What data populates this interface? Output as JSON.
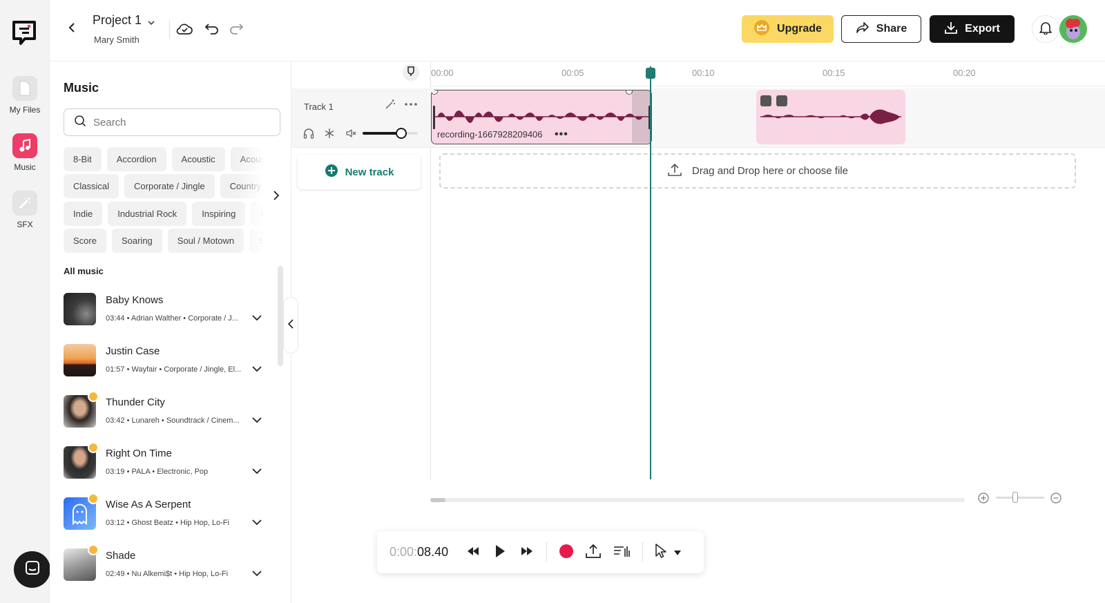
{
  "rail": {
    "items": [
      {
        "label": "My Files",
        "icon": "file-icon"
      },
      {
        "label": "Music",
        "icon": "music-note-icon"
      },
      {
        "label": "SFX",
        "icon": "magic-wand-icon"
      }
    ]
  },
  "header": {
    "project_title": "Project 1",
    "user_name": "Mary Smith",
    "upgrade_label": "Upgrade",
    "share_label": "Share",
    "export_label": "Export"
  },
  "panel": {
    "title": "Music",
    "search_placeholder": "Search",
    "chip_rows": [
      [
        "8-Bit",
        "Accordion",
        "Acoustic",
        "Acoustic"
      ],
      [
        "Classical",
        "Corporate / Jingle",
        "Country"
      ],
      [
        "Indie",
        "Industrial Rock",
        "Inspiring",
        "Inte"
      ],
      [
        "Score",
        "Soaring",
        "Soul / Motown",
        "Sou"
      ]
    ],
    "section_label": "All music",
    "songs": [
      {
        "title": "Baby Knows",
        "duration": "03:44",
        "artist": "Adrian Walther",
        "genre": "Corporate / J...",
        "premium": false
      },
      {
        "title": "Justin Case",
        "duration": "01:57",
        "artist": "Wayfair",
        "genre": "Corporate / Jingle, El...",
        "premium": false
      },
      {
        "title": "Thunder City",
        "duration": "03:42",
        "artist": "Lunareh",
        "genre": "Soundtrack / Cinem...",
        "premium": true
      },
      {
        "title": "Right On Time",
        "duration": "03:19",
        "artist": "PALA",
        "genre": "Electronic, Pop",
        "premium": true
      },
      {
        "title": "Wise As A Serpent",
        "duration": "03:12",
        "artist": "Ghost Beatz",
        "genre": "Hip Hop, Lo-Fi",
        "premium": true
      },
      {
        "title": "Shade",
        "duration": "02:49",
        "artist": "Nu Alkemi$t",
        "genre": "Hip Hop, Lo-Fi",
        "premium": true
      }
    ]
  },
  "timeline": {
    "ruler_ticks": [
      "00:00",
      "00:05",
      "00:10",
      "00:15",
      "00:20"
    ],
    "track_name": "Track 1",
    "volume_fraction": 0.7,
    "clip_name": "recording-1667928209406",
    "new_track_label": "New track",
    "dropzone_label": "Drag and Drop here or choose file"
  },
  "transport": {
    "time_dim": "0:00:",
    "time_main": "08.40"
  },
  "colors": {
    "accent_teal": "#1f7c72",
    "music_pink": "#ee3d67",
    "clip_pink": "#f9d6e4",
    "wave": "#7a1f45",
    "upgrade_yellow": "#fad863",
    "record_red": "#e8194a"
  }
}
